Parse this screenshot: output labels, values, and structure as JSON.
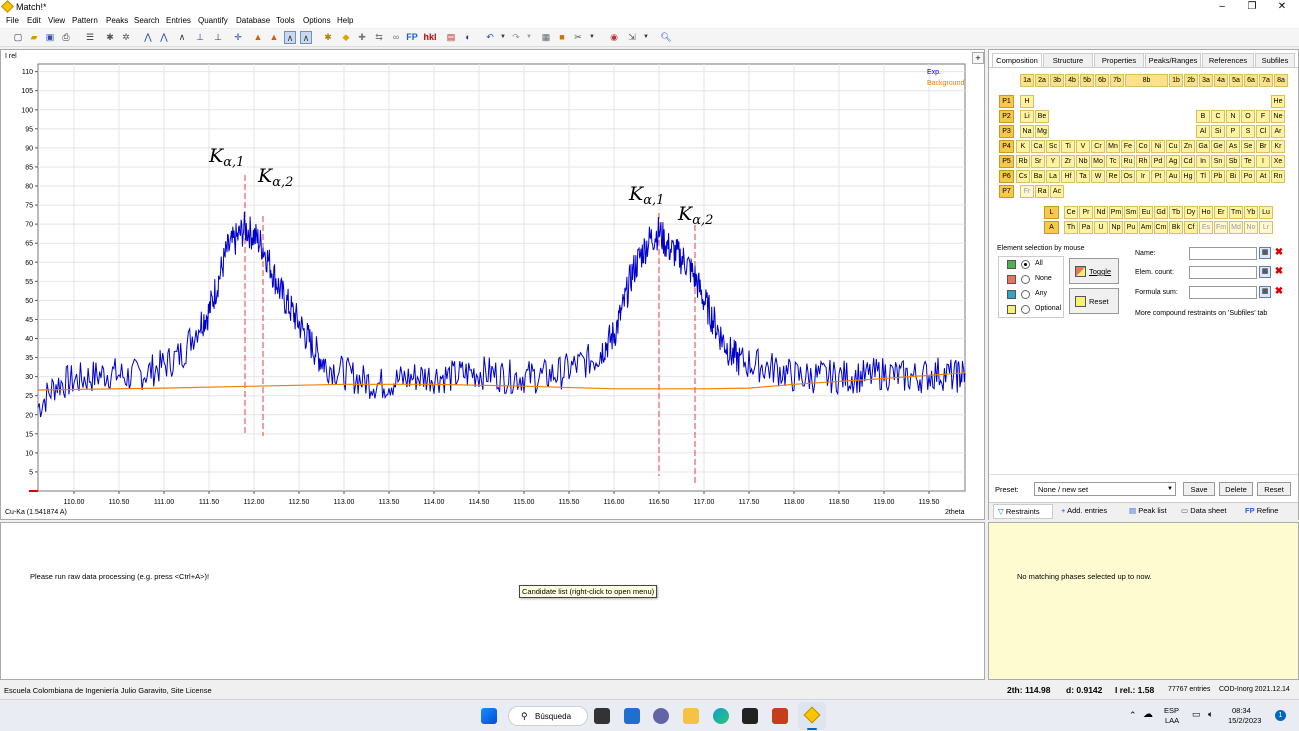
{
  "window": {
    "title": "Match!*",
    "controls": [
      "–",
      "❐",
      "✕"
    ]
  },
  "menu": [
    "File",
    "Edit",
    "View",
    "Pattern",
    "Peaks",
    "Search",
    "Entries",
    "Quantify",
    "Database",
    "Tools",
    "Options",
    "Help"
  ],
  "toolbar": {
    "fp_label": "FP",
    "hkl_label": "hkl"
  },
  "chart": {
    "y_axis_label": "I rel",
    "x_axis_label": "2theta",
    "wavelength_label": "Cu-Ka (1.541874 A)",
    "plus_button": "+",
    "annotations": [
      {
        "label": "Kα,1",
        "x": 111.9
      },
      {
        "label": "Kα,2",
        "x": 112.1
      },
      {
        "label": "Kα,1",
        "x": 116.5
      },
      {
        "label": "Kα,2",
        "x": 116.9
      }
    ]
  },
  "chart_data": {
    "type": "line",
    "xlabel": "2theta",
    "ylabel": "I rel",
    "xlim": [
      109.6,
      119.9
    ],
    "ylim": [
      0,
      112
    ],
    "x_ticks": [
      "110.00",
      "110.50",
      "111.00",
      "111.50",
      "112.00",
      "112.50",
      "113.00",
      "113.50",
      "114.00",
      "114.50",
      "115.00",
      "115.50",
      "116.00",
      "116.50",
      "117.00",
      "117.50",
      "118.00",
      "118.50",
      "119.00",
      "119.50"
    ],
    "y_ticks": [
      5,
      10,
      15,
      20,
      25,
      30,
      35,
      40,
      45,
      50,
      55,
      60,
      65,
      70,
      75,
      80,
      85,
      90,
      95,
      100,
      105,
      110
    ],
    "legend_position": "top-right",
    "grid": true,
    "series": [
      {
        "name": "Exp.",
        "color": "#0000cc",
        "x": [
          109.6,
          109.8,
          110.0,
          110.2,
          110.4,
          110.6,
          110.8,
          111.0,
          111.2,
          111.4,
          111.5,
          111.6,
          111.7,
          111.8,
          111.9,
          112.0,
          112.1,
          112.2,
          112.3,
          112.4,
          112.5,
          112.6,
          112.7,
          112.8,
          113.0,
          113.2,
          113.4,
          113.6,
          113.8,
          114.0,
          114.2,
          114.4,
          114.6,
          114.8,
          115.0,
          115.2,
          115.4,
          115.6,
          115.8,
          115.9,
          116.0,
          116.1,
          116.2,
          116.3,
          116.4,
          116.5,
          116.6,
          116.7,
          116.8,
          116.9,
          117.0,
          117.1,
          117.2,
          117.3,
          117.4,
          117.6,
          117.8,
          118.0,
          118.2,
          118.4,
          118.6,
          118.8,
          119.0,
          119.2,
          119.4,
          119.6,
          119.8,
          119.9
        ],
        "y": [
          22,
          28,
          29,
          30,
          31,
          30,
          31,
          33,
          36,
          44,
          47,
          55,
          63,
          66,
          69,
          67,
          64,
          58,
          52,
          48,
          44,
          40,
          36,
          33,
          31,
          29,
          28,
          29,
          30,
          30,
          30,
          31,
          31,
          30,
          30,
          30,
          31,
          33,
          35,
          38,
          41,
          48,
          57,
          62,
          66,
          68,
          64,
          62,
          60,
          56,
          50,
          45,
          40,
          36,
          34,
          33,
          32,
          30,
          30,
          30,
          30,
          30,
          31,
          30,
          30,
          31,
          30,
          31
        ]
      },
      {
        "name": "Background",
        "color": "#f08000",
        "x": [
          109.6,
          111.0,
          112.0,
          113.0,
          114.0,
          115.0,
          116.0,
          117.0,
          117.5,
          118.0,
          119.0,
          119.9
        ],
        "y": [
          26.5,
          27,
          27.5,
          28,
          28,
          27.5,
          26.8,
          26.8,
          27,
          28,
          29.5,
          31
        ]
      }
    ]
  },
  "right_panel": {
    "tabs": [
      "Composition",
      "Structure",
      "Properties",
      "Peaks/Ranges",
      "References",
      "Subfiles"
    ],
    "groups": [
      "1a",
      "2a",
      "3b",
      "4b",
      "5b",
      "6b",
      "7b",
      "8b",
      "1b",
      "2b",
      "3a",
      "4a",
      "5a",
      "6a",
      "7a",
      "8a"
    ],
    "periods": [
      "P1",
      "P2",
      "P3",
      "P4",
      "P5",
      "P6",
      "P7"
    ],
    "rows": [
      {
        "left": [
          "H"
        ],
        "right": [
          "He"
        ]
      },
      {
        "left": [
          "Li",
          "Be"
        ],
        "right": [
          "B",
          "C",
          "N",
          "O",
          "F",
          "Ne"
        ]
      },
      {
        "left": [
          "Na",
          "Mg"
        ],
        "right": [
          "Al",
          "Si",
          "P",
          "S",
          "Cl",
          "Ar"
        ]
      },
      {
        "all": [
          "K",
          "Ca",
          "Sc",
          "Ti",
          "V",
          "Cr",
          "Mn",
          "Fe",
          "Co",
          "Ni",
          "Cu",
          "Zn",
          "Ga",
          "Ge",
          "As",
          "Se",
          "Br",
          "Kr"
        ]
      },
      {
        "all": [
          "Rb",
          "Sr",
          "Y",
          "Zr",
          "Nb",
          "Mo",
          "Tc",
          "Ru",
          "Rh",
          "Pd",
          "Ag",
          "Cd",
          "In",
          "Sn",
          "Sb",
          "Te",
          "I",
          "Xe"
        ]
      },
      {
        "all": [
          "Cs",
          "Ba",
          "La",
          "Hf",
          "Ta",
          "W",
          "Re",
          "Os",
          "Ir",
          "Pt",
          "Au",
          "Hg",
          "Tl",
          "Pb",
          "Bi",
          "Po",
          "At",
          "Rn"
        ]
      },
      {
        "left": [
          "Fr",
          "Ra",
          "Ac"
        ]
      }
    ],
    "lanthanide_label": "L",
    "actinide_label": "A",
    "lanthanides": [
      "Ce",
      "Pr",
      "Nd",
      "Pm",
      "Sm",
      "Eu",
      "Gd",
      "Tb",
      "Dy",
      "Ho",
      "Er",
      "Tm",
      "Yb",
      "Lu"
    ],
    "actinides": [
      "Th",
      "Pa",
      "U",
      "Np",
      "Pu",
      "Am",
      "Cm",
      "Bk",
      "Cf",
      "Es",
      "Fm",
      "Md",
      "No",
      "Lr"
    ],
    "selection_title": "Element selection by mouse",
    "selection_options": [
      "All",
      "None",
      "Any",
      "Optional"
    ],
    "toggle_label": "Toggle",
    "reset_label": "Reset",
    "name_label": "Name:",
    "elem_count_label": "Elem. count:",
    "formula_sum_label": "Formula sum:",
    "restraints_note": "More compound restraints on 'Subfiles' tab",
    "preset_label": "Preset:",
    "preset_value": "None / new set",
    "save_label": "Save",
    "delete_label": "Delete",
    "reset2_label": "Reset",
    "bottom_tabs": [
      "Restraints",
      "Add. entries",
      "Peak list",
      "Data sheet",
      "Refine"
    ]
  },
  "bottom_left": {
    "message": "Please run raw data processing (e.g. press <Ctrl+A>)!",
    "tooltip": "Candidate list (right-click to open menu)"
  },
  "bottom_right": {
    "message": "No matching phases selected up to now."
  },
  "status": {
    "license": "Escuela Colombiana de Ingeniería Julio Garavito, Site License",
    "two_theta": "2th: 114.98",
    "d": "d: 0.9142",
    "irel": "I rel.: 1.58",
    "entries": "77767 entries",
    "db": "COD-Inorg 2021.12.14"
  },
  "taskbar": {
    "search": "Búsqueda",
    "lang": "ESP",
    "lang2": "LAA",
    "time": "08:34",
    "date": "15/2/2023",
    "notif": "1"
  }
}
